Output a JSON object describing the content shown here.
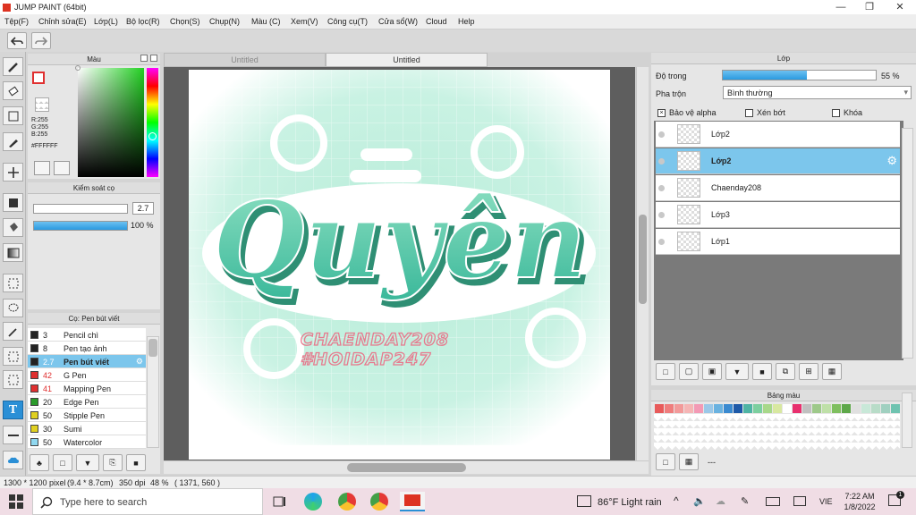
{
  "window": {
    "title": "JUMP PAINT (64bit)"
  },
  "menu": [
    "Tệp(F)",
    "Chỉnh sửa(E)",
    "Lớp(L)",
    "Bộ lọc(R)",
    "Chọn(S)",
    "Chụp(N)",
    "Màu (C)",
    "Xem(V)",
    "Công cụ(T)",
    "Cửa sổ(W)",
    "Cloud",
    "Help"
  ],
  "tabs": [
    "Untitled",
    "Untitled"
  ],
  "color_panel": {
    "title": "Màu",
    "r": "R:255",
    "g": "G:255",
    "b": "B:255",
    "hex": "#FFFFFF"
  },
  "brush_control": {
    "title": "Kiểm soát cọ",
    "size": "2.7",
    "opacity": "100 %",
    "opacity_value": 1.0
  },
  "brush_panel": {
    "title": "Cọ: Pen bút viết",
    "items": [
      {
        "size": "3",
        "name": "Pencil chì",
        "color": "#222222"
      },
      {
        "size": "8",
        "name": "Pen tạo ảnh",
        "color": "#222222"
      },
      {
        "size": "2.7",
        "name": "Pen bút viết",
        "color": "#222222",
        "selected": true
      },
      {
        "size": "42",
        "name": "G Pen",
        "color": "#e03030"
      },
      {
        "size": "41",
        "name": "Mapping Pen",
        "color": "#e03030"
      },
      {
        "size": "20",
        "name": "Edge Pen",
        "color": "#2a9a2a"
      },
      {
        "size": "50",
        "name": "Stipple Pen",
        "color": "#e0d020"
      },
      {
        "size": "30",
        "name": "Sumi",
        "color": "#e0d020"
      },
      {
        "size": "50",
        "name": "Watercolor",
        "color": "#90d8f0"
      }
    ]
  },
  "artwork": {
    "main": "Quyên",
    "line1": "CHAENDAY208",
    "line2": "#HOIDAP247"
  },
  "layer_panel": {
    "title": "Lớp",
    "opacity_label": "Độ trong",
    "opacity_value": "55 %",
    "opacity_fraction": 0.55,
    "blend_label": "Pha trộn",
    "blend_value": "Bình thường",
    "protect_alpha": "Bảo vệ alpha",
    "clip": "Xén bớt",
    "lock": "Khóa",
    "layers": [
      {
        "name": "Lớp2",
        "selected": false
      },
      {
        "name": "Lớp2",
        "selected": true
      },
      {
        "name": "Chaenday208",
        "selected": false
      },
      {
        "name": "Lớp3",
        "selected": false
      },
      {
        "name": "Lớp1",
        "selected": false
      }
    ]
  },
  "palette_panel": {
    "title": "Bảng màu",
    "footer": "---",
    "colors": [
      "#e85a5a",
      "#ef7d7d",
      "#f29a9a",
      "#f5b5b5",
      "#f39ab5",
      "#9bc8e8",
      "#6ab2e0",
      "#3a8ad0",
      "#1e5aa8",
      "#4fb4a4",
      "#7ccf9f",
      "#a8d88a",
      "#d8e8a0",
      "#ffffff",
      "#e8306e",
      "#c0c0c0",
      "#9ec98a",
      "#bfe0a8",
      "#7fbf5f",
      "#5ea84a",
      "#e0e0e0",
      "#c8e8d8",
      "#b8dcc8",
      "#a0d0c0",
      "#6fc3b0"
    ]
  },
  "status": {
    "size": "1300 * 1200 pixel",
    "cm": "(9.4 * 8.7cm)",
    "dpi": "350 dpi",
    "zoom": "48 %",
    "coords": "( 1371, 560 )"
  },
  "taskbar": {
    "search_placeholder": "Type here to search",
    "weather": "86°F  Light rain",
    "lang": "VIE",
    "time": "7:22 AM",
    "date": "1/8/2022"
  }
}
